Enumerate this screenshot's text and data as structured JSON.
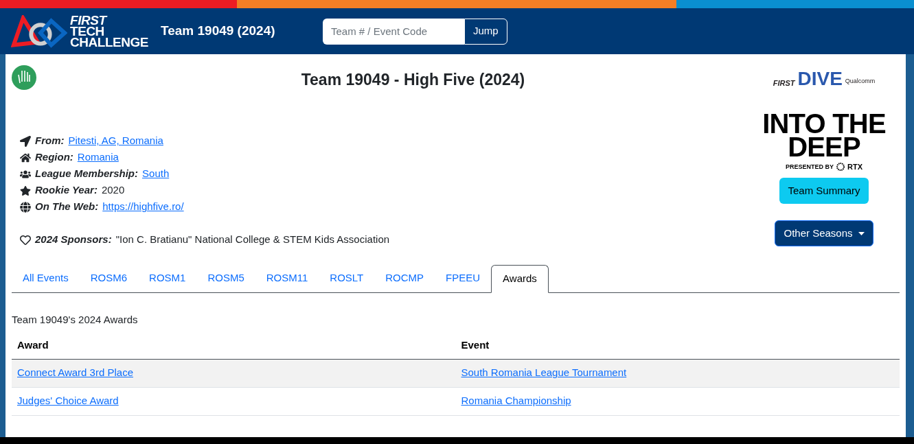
{
  "header": {
    "logo": {
      "line_1": "FIRST",
      "line_2": "TECH",
      "line_3": "CHALLENGE"
    },
    "title": "Team 19049 (2024)",
    "search": {
      "placeholder": "Team # / Event Code",
      "button": "Jump"
    }
  },
  "page_title": "Team 19049 - High Five (2024)",
  "season_logo": {
    "first": "FIRST",
    "dive": "DIVE",
    "sponsor": "Qualcomm",
    "game_line_1": "INTO THE",
    "game_line_2": "DEEP",
    "presented_by": "PRESENTED BY",
    "presenter": "RTX"
  },
  "info": [
    {
      "label": "From:",
      "value": "Pitesti, AG, Romania",
      "kind": "link"
    },
    {
      "label": "Region:",
      "value": "Romania",
      "kind": "link"
    },
    {
      "label": "League Membership:",
      "value": "South",
      "kind": "link"
    },
    {
      "label": "Rookie Year:",
      "value": "2020",
      "kind": "text"
    },
    {
      "label": "On The Web:",
      "value": "https://highfive.ro/",
      "kind": "link"
    }
  ],
  "sponsors": {
    "label": "2024 Sponsors:",
    "value": "\"Ion C. Bratianu\" National College & STEM Kids Association"
  },
  "buttons": {
    "summary": "Team Summary",
    "seasons": "Other Seasons"
  },
  "tabs": [
    {
      "label": "All Events",
      "selected": false
    },
    {
      "label": "ROSM6",
      "selected": false
    },
    {
      "label": "ROSM1",
      "selected": false
    },
    {
      "label": "ROSM5",
      "selected": false
    },
    {
      "label": "ROSM11",
      "selected": false
    },
    {
      "label": "ROSLT",
      "selected": false
    },
    {
      "label": "ROCMP",
      "selected": false
    },
    {
      "label": "FPEEU",
      "selected": false
    },
    {
      "label": "Awards",
      "selected": true
    }
  ],
  "awards_caption": "Team 19049's 2024 Awards",
  "table": {
    "columns": [
      "Award",
      "Event"
    ],
    "rows": [
      [
        "Connect Award 3rd Place",
        "South Romania League Tournament"
      ],
      [
        "Judges' Choice Award",
        "Romania Championship"
      ]
    ]
  }
}
